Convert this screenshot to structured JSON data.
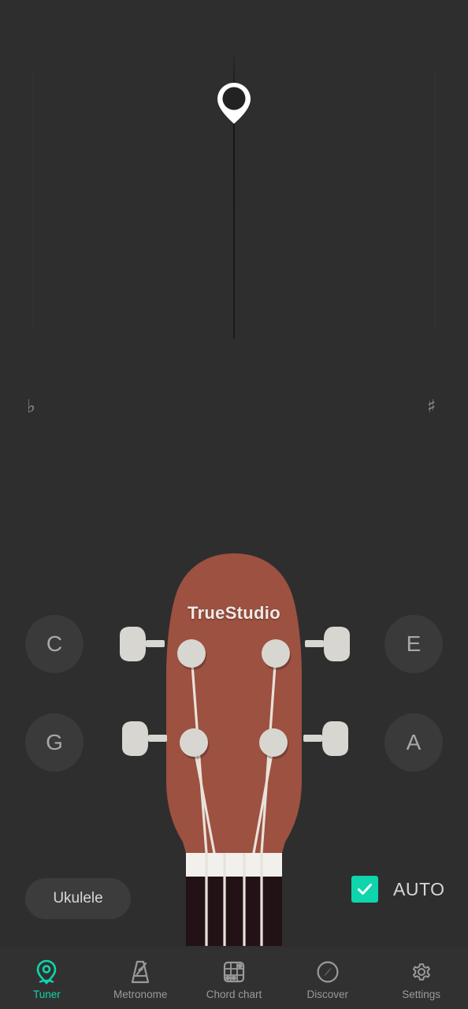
{
  "app": {
    "background_color": "#2e2e2e",
    "accent_color": "#0fd5ac"
  },
  "tuner": {
    "needle_icon": "pin-marker-icon",
    "flat_symbol": "♭",
    "sharp_symbol": "♯",
    "flat_icon_name": "flat-symbol",
    "sharp_icon_name": "sharp-symbol",
    "needle_position_percent": 50
  },
  "headstock": {
    "brand": "TrueStudio",
    "wood_color": "#9d5140",
    "nut_color": "#f2f0ec",
    "fretboard_color": "#221215",
    "string_color": "#e8e2da",
    "string_count": 4
  },
  "strings": [
    {
      "id": "string-c",
      "note": "C",
      "side": "left",
      "row": "top"
    },
    {
      "id": "string-e",
      "note": "E",
      "side": "right",
      "row": "top"
    },
    {
      "id": "string-g",
      "note": "G",
      "side": "left",
      "row": "bottom"
    },
    {
      "id": "string-a",
      "note": "A",
      "side": "right",
      "row": "bottom"
    }
  ],
  "controls": {
    "instrument": "Ukulele",
    "auto_label": "AUTO",
    "auto_checked": true
  },
  "nav": {
    "items": [
      {
        "label": "Tuner",
        "icon": "tuner-pin-icon",
        "active": true
      },
      {
        "label": "Metronome",
        "icon": "metronome-icon",
        "active": false
      },
      {
        "label": "Chord chart",
        "icon": "chord-chart-icon",
        "active": false
      },
      {
        "label": "Discover",
        "icon": "compass-icon",
        "active": false
      },
      {
        "label": "Settings",
        "icon": "gear-icon",
        "active": false
      }
    ]
  }
}
